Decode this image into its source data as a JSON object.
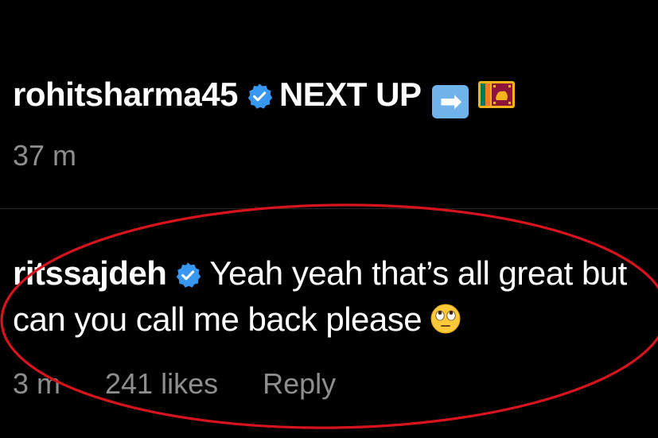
{
  "colors": {
    "background": "#000000",
    "text_primary": "#ffffff",
    "text_secondary": "#8e8e8e",
    "verified_badge": "#3897f0",
    "divider": "#262626",
    "annotation_ellipse": "#d7141e"
  },
  "comments": [
    {
      "username": "rohitsharma45",
      "verified": true,
      "verified_icon": "verified-badge-icon",
      "text": "NEXT UP",
      "emojis": [
        "right-arrow-emoji",
        "sri-lanka-flag-emoji"
      ],
      "arrow_glyph": "➡",
      "time": "37 m"
    },
    {
      "username": "ritssajdeh",
      "verified": true,
      "verified_icon": "verified-badge-icon",
      "text_line1": "Yeah yeah that’s all great but",
      "text_line2": "can you call me back please",
      "emojis": [
        "face-with-rolling-eyes-emoji"
      ],
      "time": "3 m",
      "likes": "241 likes",
      "reply_label": "Reply"
    }
  ]
}
